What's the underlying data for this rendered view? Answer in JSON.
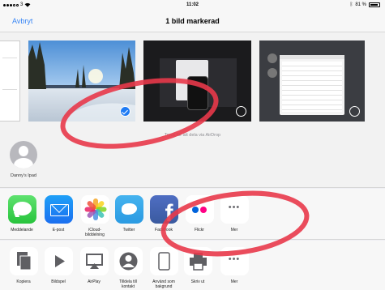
{
  "status": {
    "carrier": "3",
    "time": "11:02",
    "battery": "81 %"
  },
  "nav": {
    "cancel_label": "Avbryt",
    "title": "1 bild markerad"
  },
  "airdrop": {
    "hint": "Tryck för att dela via AirDrop",
    "devices": [
      {
        "label": "Danny's Ipad"
      }
    ]
  },
  "apps": [
    {
      "label": "Meddelande",
      "icon": "messages-icon"
    },
    {
      "label": "E-post",
      "icon": "mail-icon"
    },
    {
      "label": "iCloud-\nbilddelning",
      "icon": "photos-icon"
    },
    {
      "label": "Twitter",
      "icon": "twitter-icon"
    },
    {
      "label": "Facebook",
      "icon": "facebook-icon"
    },
    {
      "label": "Flickr",
      "icon": "flickr-icon"
    },
    {
      "label": "Mer",
      "icon": "more-icon"
    }
  ],
  "actions": [
    {
      "label": "Kopiera",
      "icon": "copy-icon"
    },
    {
      "label": "Bildspel",
      "icon": "slideshow-icon"
    },
    {
      "label": "AirPlay",
      "icon": "airplay-icon"
    },
    {
      "label": "Tilldela till\nkontakt",
      "icon": "assign-contact-icon"
    },
    {
      "label": "Använd som\nbakgrund",
      "icon": "wallpaper-icon"
    },
    {
      "label": "Skriv ut",
      "icon": "print-icon"
    },
    {
      "label": "Mer",
      "icon": "more-icon"
    }
  ],
  "colors": {
    "accent": "#3a87f5",
    "annotation": "#e8394a",
    "selected_check": "#1e7bf4"
  }
}
